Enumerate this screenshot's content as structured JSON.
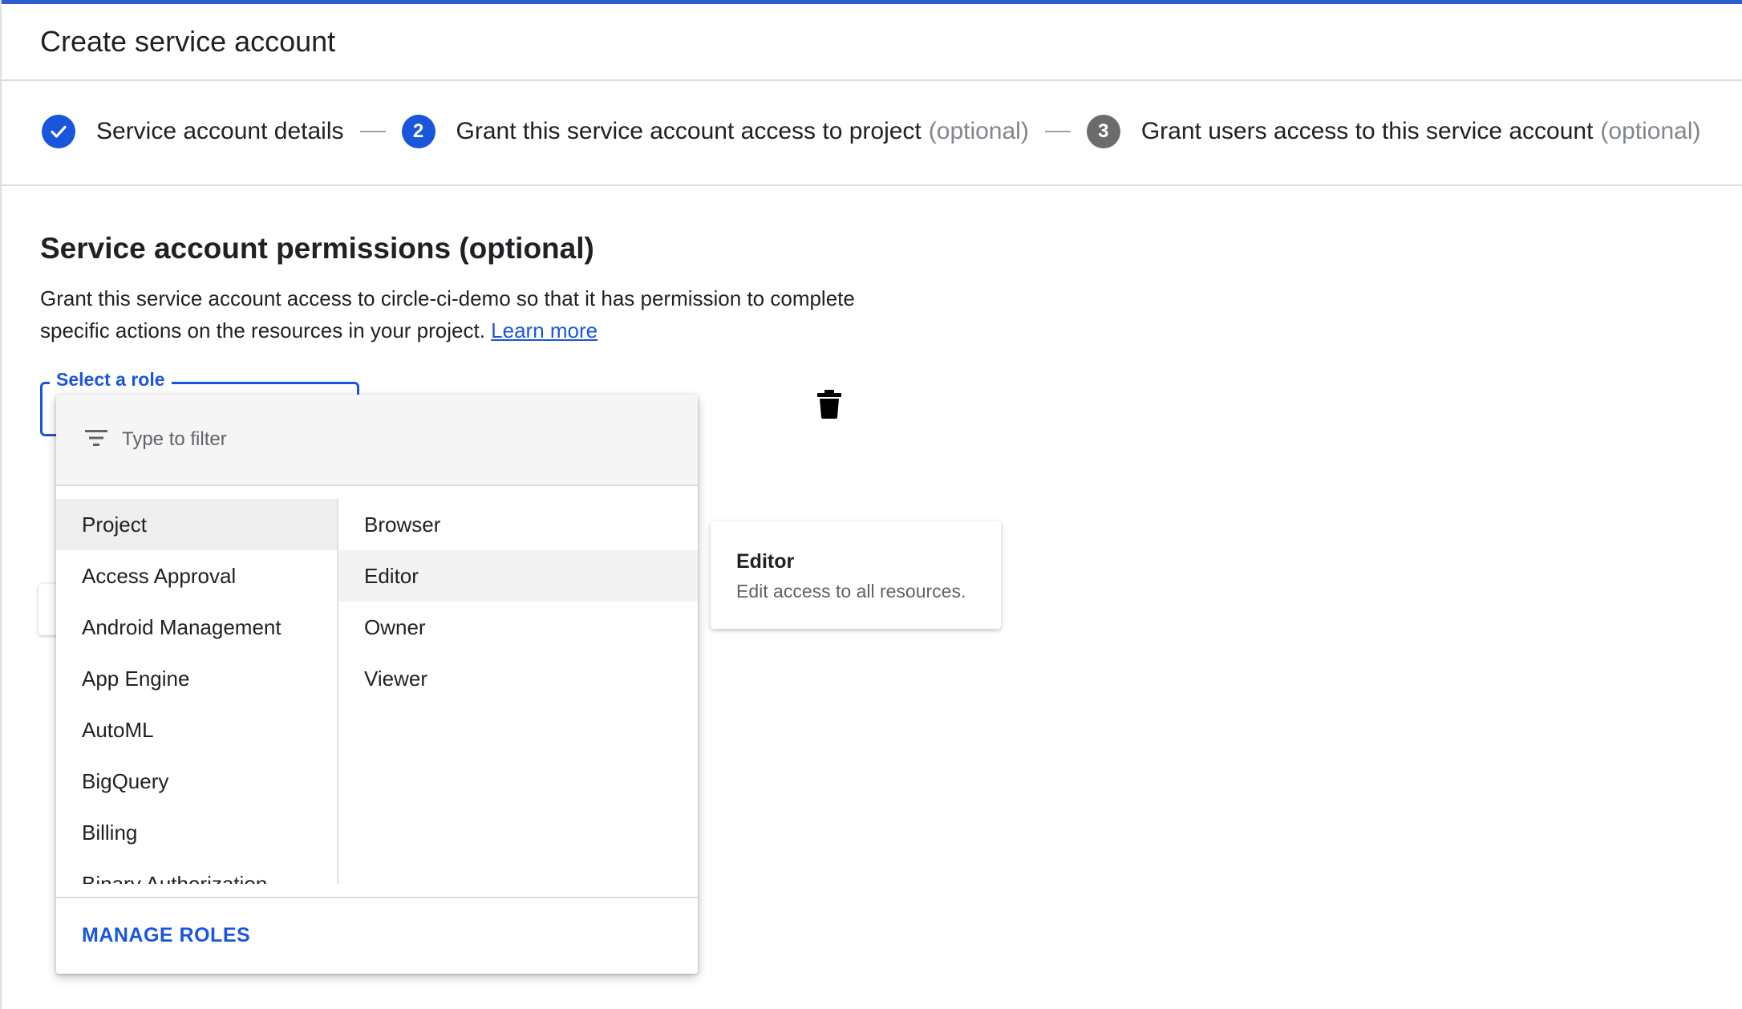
{
  "header": {
    "title": "Create service account"
  },
  "stepper": {
    "steps": [
      {
        "label": "Service account details",
        "status": "done",
        "icon": "check-icon"
      },
      {
        "number": "2",
        "label": "Grant this service account access to project",
        "optional": "(optional)",
        "status": "active"
      },
      {
        "number": "3",
        "label": "Grant users access to this service account",
        "optional": "(optional)",
        "status": "pending"
      }
    ]
  },
  "permissions": {
    "title": "Service account permissions (optional)",
    "description": "Grant this service account access to circle-ci-demo so that it has permission to complete specific actions on the resources in your project.",
    "learn_more": "Learn more",
    "role_label": "Select a role"
  },
  "dropdown": {
    "filter_placeholder": "Type to filter",
    "categories": [
      "Project",
      "Access Approval",
      "Android Management",
      "App Engine",
      "AutoML",
      "BigQuery",
      "Billing",
      "Binary Authorization"
    ],
    "selected_category": "Project",
    "roles": [
      "Browser",
      "Editor",
      "Owner",
      "Viewer"
    ],
    "hovered_role": "Editor",
    "manage_roles": "MANAGE ROLES"
  },
  "tooltip": {
    "title": "Editor",
    "description": "Edit access to all resources."
  },
  "colors": {
    "accent": "#1a56db",
    "step_pending": "#6b6b6b",
    "topbar": "#2d5bd0"
  }
}
